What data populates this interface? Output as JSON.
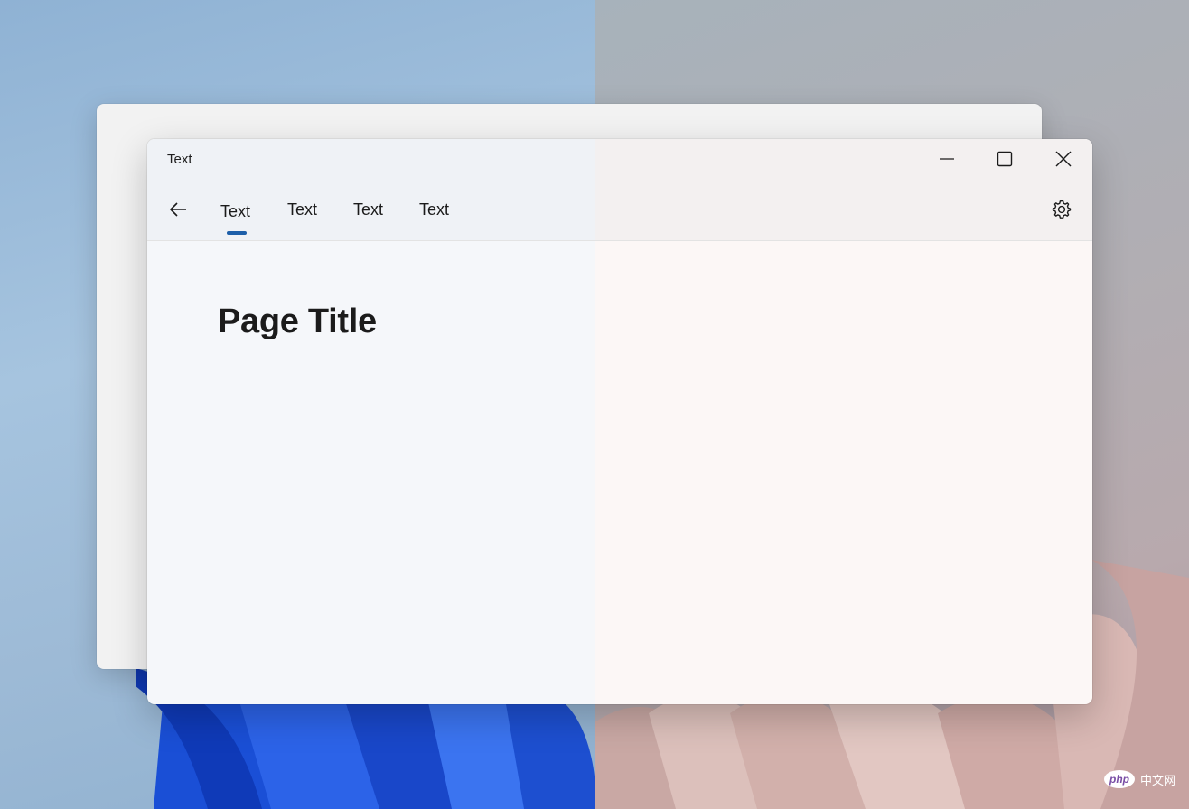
{
  "window": {
    "title": "Text",
    "caption_buttons": {
      "minimize": "minimize",
      "maximize": "maximize",
      "close": "close"
    }
  },
  "nav": {
    "back_icon": "back-arrow-icon",
    "tabs": [
      {
        "label": "Text",
        "selected": true
      },
      {
        "label": "Text",
        "selected": false
      },
      {
        "label": "Text",
        "selected": false
      },
      {
        "label": "Text",
        "selected": false
      }
    ],
    "settings_icon": "gear-icon"
  },
  "page": {
    "title": "Page Title"
  },
  "watermark": {
    "logo": "php",
    "text": "中文网"
  },
  "colors": {
    "accent": "#1d5fa9",
    "text": "#1b1b1b"
  }
}
